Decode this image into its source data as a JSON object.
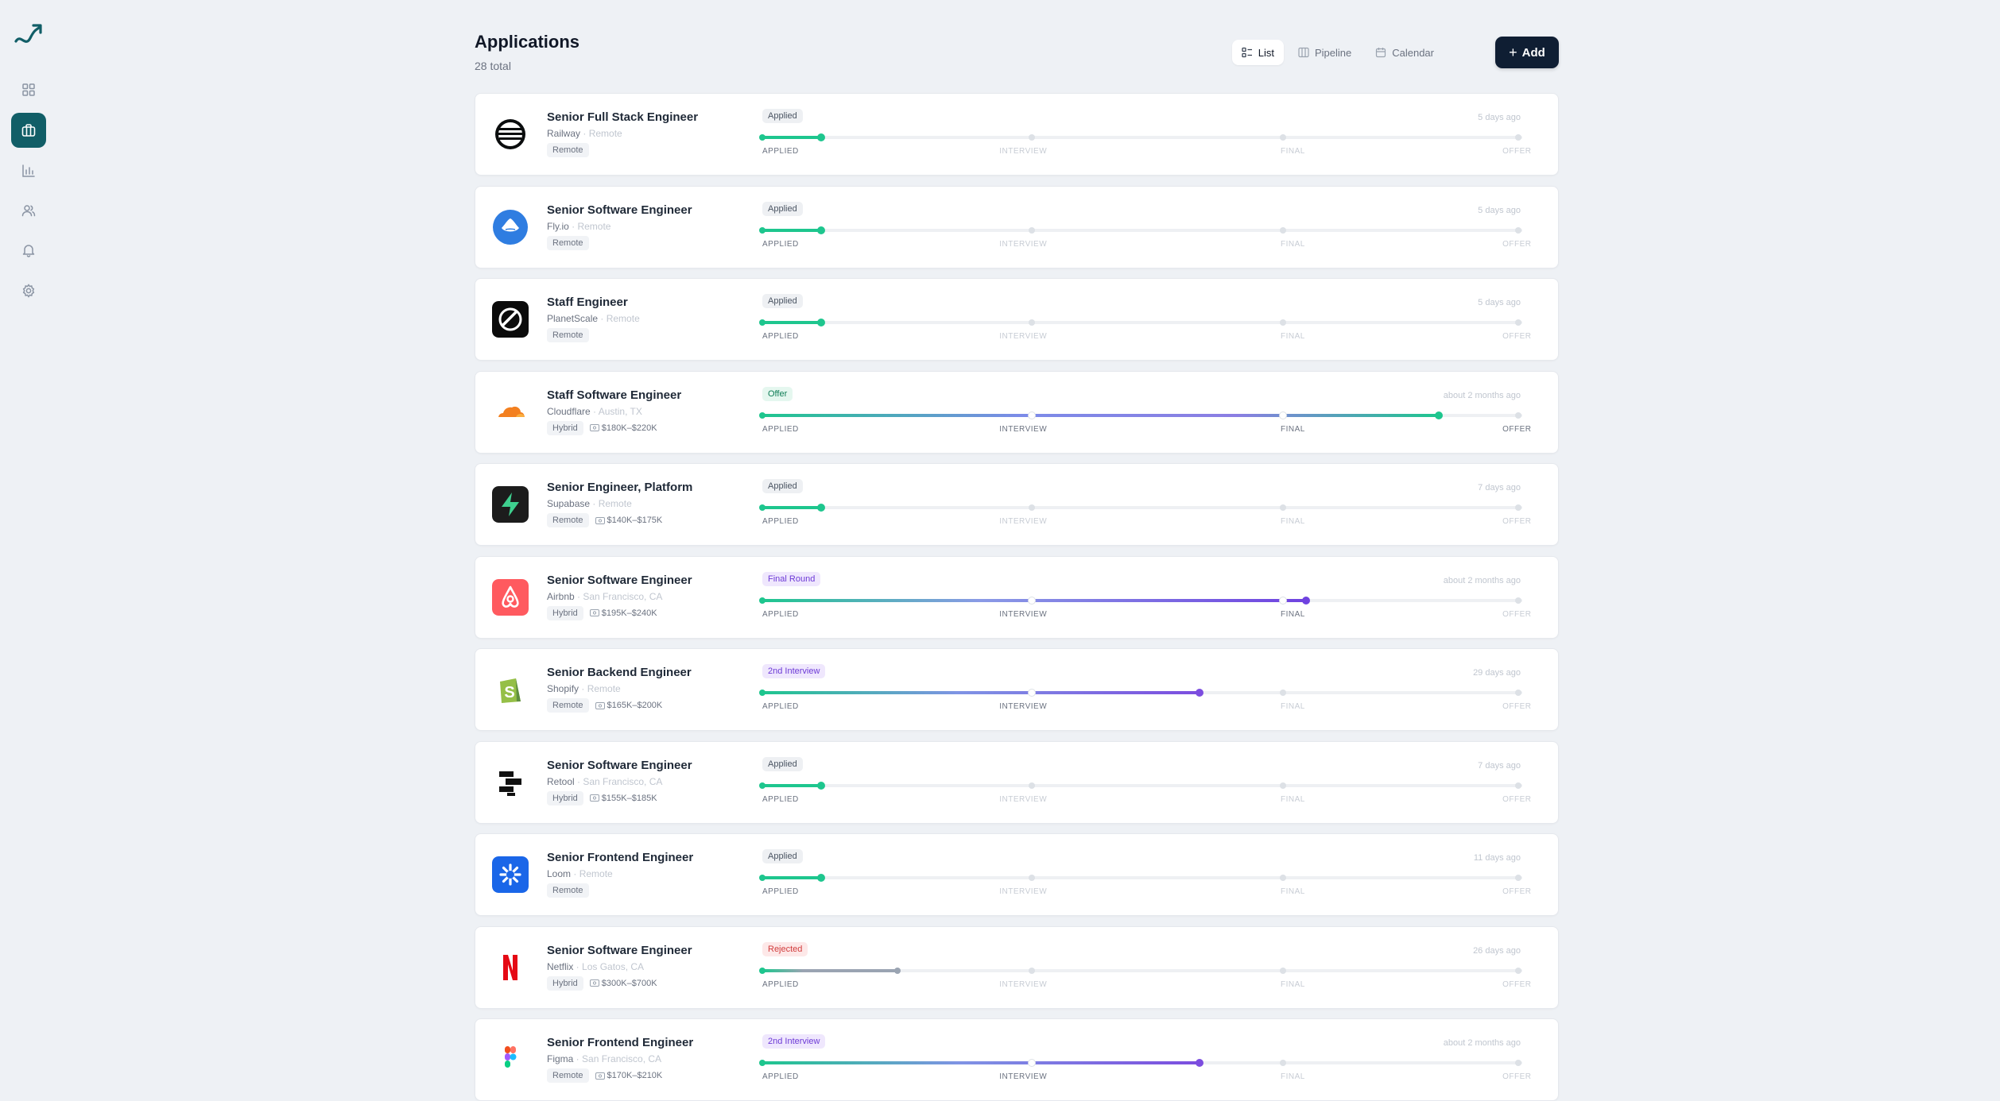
{
  "page": {
    "title": "Applications",
    "subtitle": "28 total"
  },
  "views": [
    {
      "label": "List",
      "icon": "list-icon"
    },
    {
      "label": "Pipeline",
      "icon": "pipeline-icon"
    },
    {
      "label": "Calendar",
      "icon": "calendar-icon"
    }
  ],
  "add_button": {
    "label": "Add"
  },
  "sidebar": [
    {
      "icon": "dashboard-icon"
    },
    {
      "icon": "briefcase-icon",
      "active": true
    },
    {
      "icon": "chart-icon"
    },
    {
      "icon": "users-icon"
    },
    {
      "icon": "bell-icon"
    },
    {
      "icon": "settings-icon"
    }
  ],
  "stages": [
    "APPLIED",
    "INTERVIEW",
    "FINAL",
    "OFFER"
  ],
  "colors": {
    "applied": "#1ec68e",
    "interview": "#7c4ddf",
    "final": "#6f42e0",
    "offer": "#1ec68e",
    "rejected": "#9aa4b2",
    "brand": "#115e67"
  },
  "applications": [
    {
      "title": "Senior Full Stack Engineer",
      "company": "Railway",
      "location": "Remote",
      "work_type": "Remote",
      "salary": "",
      "status": "Applied",
      "status_key": "applied",
      "progress": 0.077,
      "stage_reached": 0,
      "ago": "5 days ago",
      "logo": "railway-logo"
    },
    {
      "title": "Senior Software Engineer",
      "company": "Fly.io",
      "location": "Remote",
      "work_type": "Remote",
      "salary": "",
      "status": "Applied",
      "status_key": "applied",
      "progress": 0.077,
      "stage_reached": 0,
      "ago": "5 days ago",
      "logo": "flyio-logo"
    },
    {
      "title": "Staff Engineer",
      "company": "PlanetScale",
      "location": "Remote",
      "work_type": "Remote",
      "salary": "",
      "status": "Applied",
      "status_key": "applied",
      "progress": 0.077,
      "stage_reached": 0,
      "ago": "5 days ago",
      "logo": "planetscale-logo"
    },
    {
      "title": "Staff Software Engineer",
      "company": "Cloudflare",
      "location": "Austin, TX",
      "work_type": "Hybrid",
      "salary": "$180K–$220K",
      "status": "Offer",
      "status_key": "offer",
      "progress": 0.89,
      "stage_reached": 3,
      "ago": "about 2 months ago",
      "logo": "cloudflare-logo"
    },
    {
      "title": "Senior Engineer, Platform",
      "company": "Supabase",
      "location": "Remote",
      "work_type": "Remote",
      "salary": "$140K–$175K",
      "status": "Applied",
      "status_key": "applied",
      "progress": 0.077,
      "stage_reached": 0,
      "ago": "7 days ago",
      "logo": "supabase-logo"
    },
    {
      "title": "Senior Software Engineer",
      "company": "Airbnb",
      "location": "San Francisco, CA",
      "work_type": "Hybrid",
      "salary": "$195K–$240K",
      "status": "Final Round",
      "status_key": "final",
      "progress": 0.715,
      "stage_reached": 2,
      "ago": "about 2 months ago",
      "logo": "airbnb-logo"
    },
    {
      "title": "Senior Backend Engineer",
      "company": "Shopify",
      "location": "Remote",
      "work_type": "Remote",
      "salary": "$165K–$200K",
      "status": "2nd Interview",
      "status_key": "interview",
      "progress": 0.575,
      "stage_reached": 1,
      "ago": "29 days ago",
      "logo": "shopify-logo"
    },
    {
      "title": "Senior Software Engineer",
      "company": "Retool",
      "location": "San Francisco, CA",
      "work_type": "Hybrid",
      "salary": "$155K–$185K",
      "status": "Applied",
      "status_key": "applied",
      "progress": 0.077,
      "stage_reached": 0,
      "ago": "7 days ago",
      "logo": "retool-logo"
    },
    {
      "title": "Senior Frontend Engineer",
      "company": "Loom",
      "location": "Remote",
      "work_type": "Remote",
      "salary": "",
      "status": "Applied",
      "status_key": "applied",
      "progress": 0.077,
      "stage_reached": 0,
      "ago": "11 days ago",
      "logo": "loom-logo"
    },
    {
      "title": "Senior Software Engineer",
      "company": "Netflix",
      "location": "Los Gatos, CA",
      "work_type": "Hybrid",
      "salary": "$300K–$700K",
      "status": "Rejected",
      "status_key": "rejected",
      "progress": 0.178,
      "stage_reached": 0,
      "ago": "26 days ago",
      "logo": "netflix-logo"
    },
    {
      "title": "Senior Frontend Engineer",
      "company": "Figma",
      "location": "San Francisco, CA",
      "work_type": "Remote",
      "salary": "$170K–$210K",
      "status": "2nd Interview",
      "status_key": "interview",
      "progress": 0.575,
      "stage_reached": 1,
      "ago": "about 2 months ago",
      "logo": "figma-logo"
    }
  ]
}
